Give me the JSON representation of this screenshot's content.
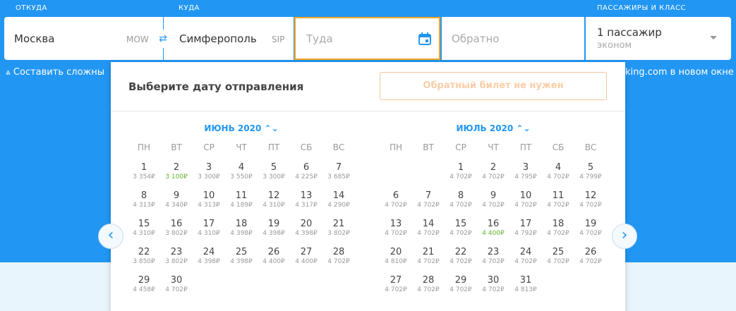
{
  "labels": {
    "from": "ОТКУДА",
    "to": "КУДА",
    "passengers": "ПАССАЖИРЫ И КЛАСС"
  },
  "search": {
    "from_city": "Москва",
    "from_code": "MOW",
    "to_city": "Симферополь",
    "to_code": "SIP",
    "depart_placeholder": "Туда",
    "return_placeholder": "Обратно",
    "passengers": "1 пассажир",
    "class": "эконом"
  },
  "links": {
    "complex_route": "Составить сложны",
    "booking": "king.com в новом окне"
  },
  "calendar": {
    "title": "Выберите дату отправления",
    "no_return": "Обратный билет не нужен",
    "weekdays": [
      "ПН",
      "ВТ",
      "СР",
      "ЧТ",
      "ПТ",
      "СБ",
      "ВС"
    ],
    "months": [
      {
        "title": "ИЮНЬ 2020 ⌃⌄",
        "offset": 0,
        "days": [
          {
            "d": "1",
            "p": "3 354₽"
          },
          {
            "d": "2",
            "p": "3 100₽",
            "cheap": true
          },
          {
            "d": "3",
            "p": "3 300₽"
          },
          {
            "d": "4",
            "p": "3 550₽"
          },
          {
            "d": "5",
            "p": "3 300₽"
          },
          {
            "d": "6",
            "p": "4 225₽"
          },
          {
            "d": "7",
            "p": "3 685₽"
          },
          {
            "d": "8",
            "p": "4 313₽"
          },
          {
            "d": "9",
            "p": "4 340₽"
          },
          {
            "d": "10",
            "p": "4 313₽"
          },
          {
            "d": "11",
            "p": "4 189₽"
          },
          {
            "d": "12",
            "p": "4 310₽"
          },
          {
            "d": "13",
            "p": "4 317₽"
          },
          {
            "d": "14",
            "p": "4 290₽"
          },
          {
            "d": "15",
            "p": "4 310₽"
          },
          {
            "d": "16",
            "p": "3 802₽"
          },
          {
            "d": "17",
            "p": "4 310₽"
          },
          {
            "d": "18",
            "p": "4 398₽"
          },
          {
            "d": "19",
            "p": "4 398₽"
          },
          {
            "d": "20",
            "p": "4 398₽"
          },
          {
            "d": "21",
            "p": "3 802₽"
          },
          {
            "d": "22",
            "p": "3 850₽"
          },
          {
            "d": "23",
            "p": "3 802₽"
          },
          {
            "d": "24",
            "p": "4 398₽"
          },
          {
            "d": "25",
            "p": "4 398₽"
          },
          {
            "d": "26",
            "p": "4 400₽"
          },
          {
            "d": "27",
            "p": "4 400₽"
          },
          {
            "d": "28",
            "p": "4 702₽"
          },
          {
            "d": "29",
            "p": "4 458₽"
          },
          {
            "d": "30",
            "p": "4 702₽"
          }
        ]
      },
      {
        "title": "ИЮЛЬ 2020 ⌃⌄",
        "offset": 2,
        "days": [
          {
            "d": "1",
            "p": "4 702₽"
          },
          {
            "d": "2",
            "p": "4 702₽"
          },
          {
            "d": "3",
            "p": "4 795₽"
          },
          {
            "d": "4",
            "p": "4 702₽"
          },
          {
            "d": "5",
            "p": "4 799₽"
          },
          {
            "d": "6",
            "p": "4 702₽"
          },
          {
            "d": "7",
            "p": "4 702₽"
          },
          {
            "d": "8",
            "p": "4 702₽"
          },
          {
            "d": "9",
            "p": "4 702₽"
          },
          {
            "d": "10",
            "p": "4 702₽"
          },
          {
            "d": "11",
            "p": "4 702₽"
          },
          {
            "d": "12",
            "p": "4 702₽"
          },
          {
            "d": "13",
            "p": "4 702₽"
          },
          {
            "d": "14",
            "p": "4 702₽"
          },
          {
            "d": "15",
            "p": "4 702₽"
          },
          {
            "d": "16",
            "p": "4 400₽",
            "cheap": true
          },
          {
            "d": "17",
            "p": "4 792₽"
          },
          {
            "d": "18",
            "p": "4 702₽"
          },
          {
            "d": "19",
            "p": "4 702₽"
          },
          {
            "d": "20",
            "p": "4 810₽"
          },
          {
            "d": "21",
            "p": "4 702₽"
          },
          {
            "d": "22",
            "p": "4 702₽"
          },
          {
            "d": "23",
            "p": "4 702₽"
          },
          {
            "d": "24",
            "p": "4 702₽"
          },
          {
            "d": "25",
            "p": "4 702₽"
          },
          {
            "d": "26",
            "p": "4 702₽"
          },
          {
            "d": "27",
            "p": "4 702₽"
          },
          {
            "d": "28",
            "p": "4 702₽"
          },
          {
            "d": "29",
            "p": "4 702₽"
          },
          {
            "d": "30",
            "p": "4 702₽"
          },
          {
            "d": "31",
            "p": "4 813₽"
          }
        ]
      }
    ]
  },
  "colors": {
    "brand": "#2196f3",
    "focus": "#f5a623",
    "cheap": "#68b22e"
  }
}
